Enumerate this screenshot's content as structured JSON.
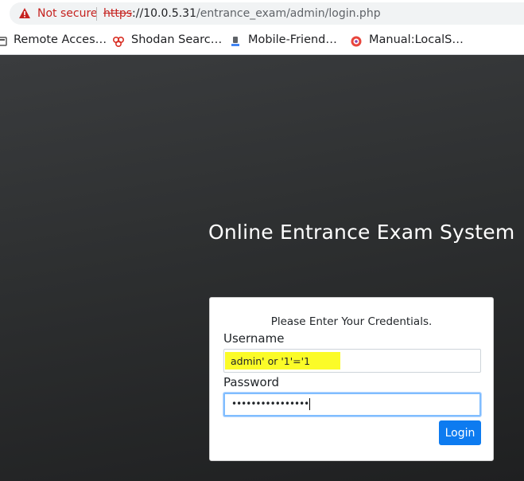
{
  "browser": {
    "security_label": "Not secure",
    "url_scheme": "https",
    "url_host": "://10.0.5.31",
    "url_path": "/entrance_exam/admin/login.php",
    "bookmarks": [
      {
        "label": "Remote Acces…",
        "icon": "bookmark-favicon"
      },
      {
        "label": "Shodan Searc…",
        "icon": "shodan-icon"
      },
      {
        "label": "Mobile-Friend…",
        "icon": "mobile-friendly-icon"
      },
      {
        "label": "Manual:LocalS…",
        "icon": "localsettings-icon"
      }
    ]
  },
  "page": {
    "title": "Online Entrance Exam System",
    "form": {
      "header": "Please Enter Your Credentials.",
      "username_label": "Username",
      "username_value": "admin' or '1'='1",
      "password_label": "Password",
      "password_value": "••••••••••••••••",
      "login_label": "Login"
    }
  },
  "colors": {
    "warning": "#c5221f",
    "highlight": "#fbfb28",
    "button": "#0d7bf0"
  }
}
